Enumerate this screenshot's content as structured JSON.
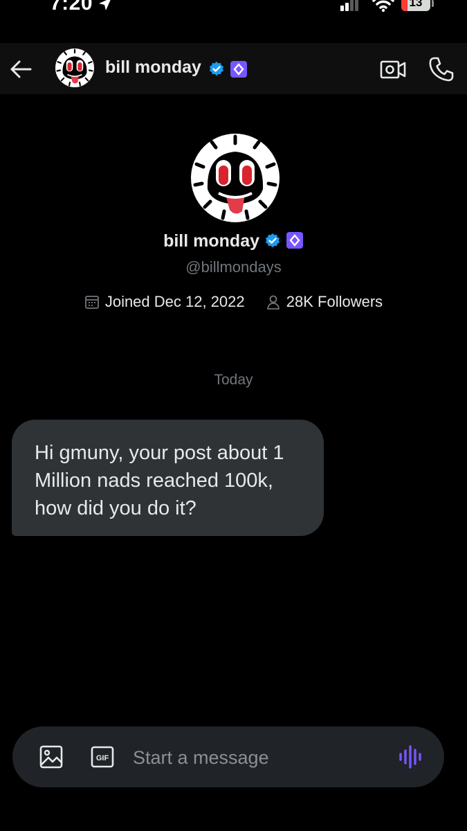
{
  "status_bar": {
    "time": "7:20",
    "battery_level": "13",
    "icons": [
      "location-arrow-icon",
      "signal-icon",
      "wifi-icon",
      "battery-icon"
    ]
  },
  "header": {
    "name": "bill monday",
    "icons": [
      "back-arrow-icon",
      "verified-badge-icon",
      "subscriber-badge-icon",
      "video-call-icon",
      "phone-icon"
    ]
  },
  "profile": {
    "name": "bill monday",
    "handle": "@billmondays",
    "joined": "Joined Dec 12, 2022",
    "followers": "28K Followers",
    "icons": [
      "calendar-icon",
      "person-icon"
    ]
  },
  "conversation": {
    "date_divider": "Today",
    "messages": [
      {
        "sender": "bill monday",
        "text": "Hi gmuny, your post about 1 Million nads reached 100k, how did you do it?"
      }
    ]
  },
  "composer": {
    "placeholder": "Start a message",
    "value": "",
    "gif_label": "GIF",
    "icons": [
      "image-icon",
      "gif-icon",
      "voice-message-icon"
    ]
  },
  "colors": {
    "background": "#000000",
    "header_background": "#0f0f0f",
    "text_primary": "#e7e9ea",
    "text_secondary": "#71767b",
    "bubble_background": "#2f3336",
    "composer_background": "#202327",
    "verified_blue": "#1d9bf0",
    "accent_purple": "#7856ff",
    "battery_red": "#ff3b30"
  }
}
